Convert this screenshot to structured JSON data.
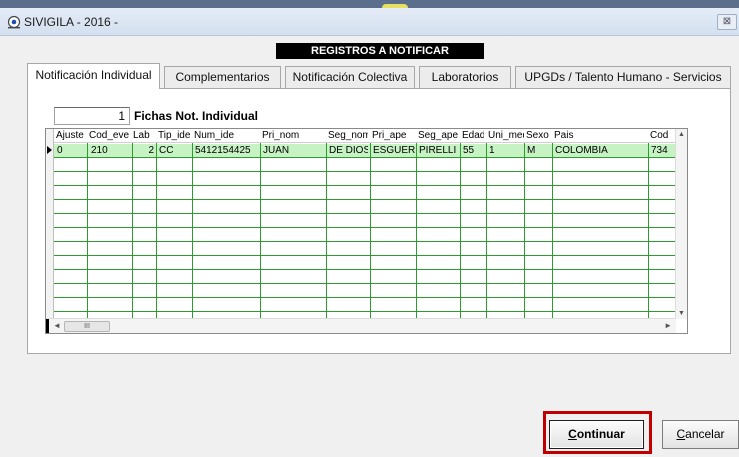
{
  "window": {
    "title": "SIVIGILA - 2016 -",
    "close_glyph": "⊠"
  },
  "banner": "REGISTROS A NOTIFICAR",
  "tabs": [
    {
      "label": "Notificación Individual",
      "active": true
    },
    {
      "label": "Complementarios",
      "active": false
    },
    {
      "label": "Notificación Colectiva",
      "active": false
    },
    {
      "label": "Laboratorios",
      "active": false
    },
    {
      "label": "UPGDs / Talento Humano - Servicios",
      "active": false
    }
  ],
  "record_count": {
    "value": "1",
    "label": "Fichas Not. Individual"
  },
  "grid": {
    "columns": [
      "Ajuste",
      "Cod_eve",
      "Lab",
      "Tip_ide",
      "Num_ide",
      "Pri_nom",
      "Seg_nom",
      "Pri_ape",
      "Seg_ape",
      "Edad",
      "Uni_med",
      "Sexo",
      "Pais",
      "Cod"
    ],
    "rows": [
      [
        "0",
        "210",
        "2",
        "CC",
        "5412154425",
        "JUAN",
        "DE DIOS",
        "ESGUERRA",
        "PIRELLI",
        "55",
        "1",
        "M",
        "COLOMBIA",
        "734"
      ]
    ]
  },
  "scroll": {
    "thumb_grip": "III"
  },
  "buttons": {
    "continue": {
      "mnemonic": "C",
      "rest": "ontinuar"
    },
    "cancel": {
      "mnemonic": "C",
      "rest": "ancelar"
    }
  },
  "colors": {
    "highlight": "#c00000",
    "row_selected": "#c7f2c4",
    "grid_lines": "#2f9a2f"
  }
}
